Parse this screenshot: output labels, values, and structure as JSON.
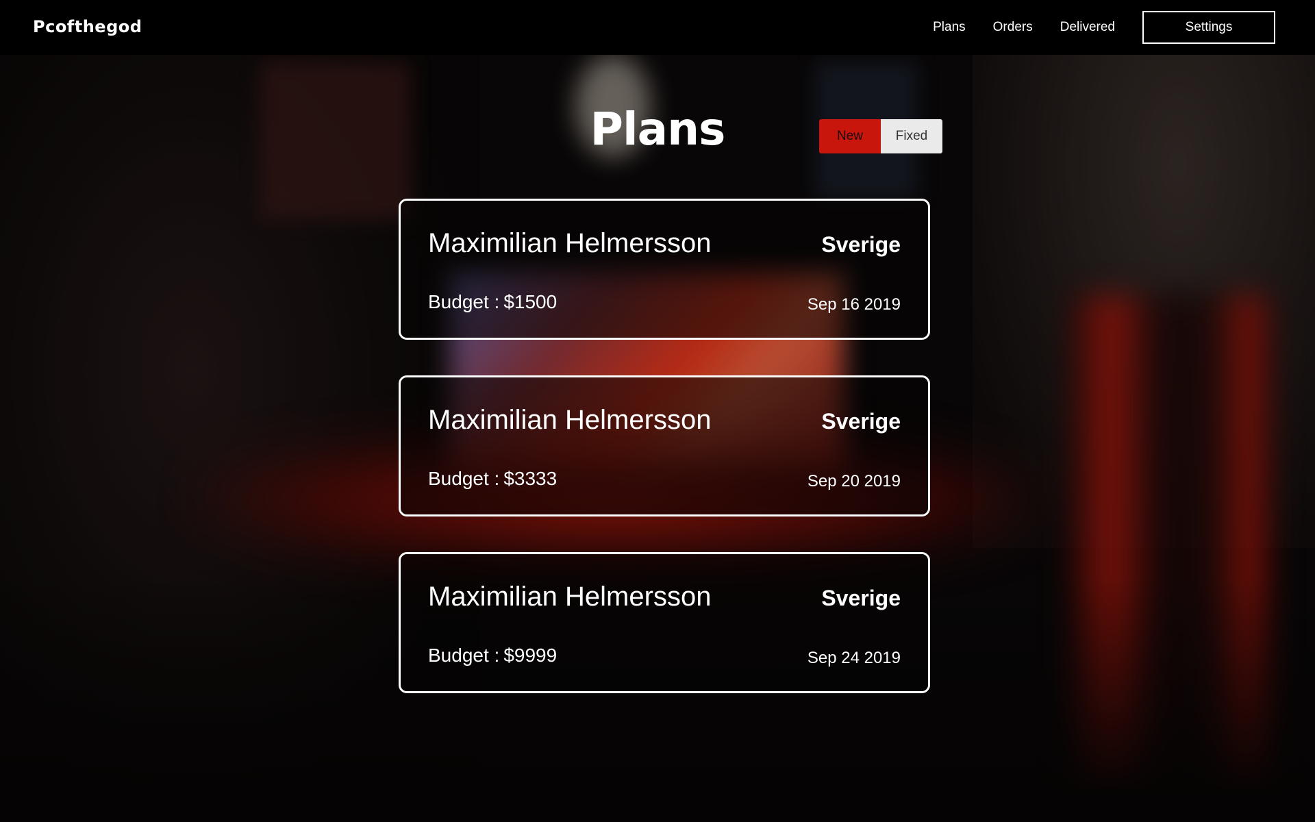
{
  "header": {
    "brand": "Pcofthegod",
    "nav": [
      {
        "label": "Plans"
      },
      {
        "label": "Orders"
      },
      {
        "label": "Delivered"
      }
    ],
    "settings_label": "Settings"
  },
  "main": {
    "title": "Plans",
    "toggle": {
      "options": [
        {
          "label": "New",
          "active": true
        },
        {
          "label": "Fixed",
          "active": false
        }
      ]
    },
    "plans": [
      {
        "name": "Maximilian Helmersson",
        "country": "Sverige",
        "budget_label": "Budget :",
        "budget": "$1500",
        "date": "Sep 16 2019"
      },
      {
        "name": "Maximilian Helmersson",
        "country": "Sverige",
        "budget_label": "Budget :",
        "budget": "$3333",
        "date": "Sep 20 2019"
      },
      {
        "name": "Maximilian Helmersson",
        "country": "Sverige",
        "budget_label": "Budget :",
        "budget": "$9999",
        "date": "Sep 24 2019"
      }
    ]
  },
  "colors": {
    "accent_red": "#c8160c",
    "toggle_inactive": "#eaeaea",
    "navbar_bg": "#000000",
    "card_border": "#ffffff"
  }
}
